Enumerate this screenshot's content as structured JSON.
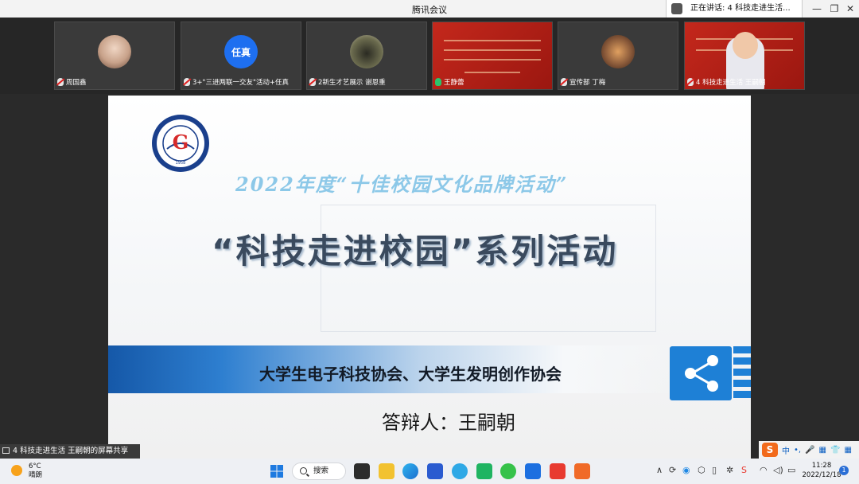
{
  "window": {
    "title": "腾讯会议",
    "speaking_now": "正在讲话: 4 科技走进生活..."
  },
  "participants": [
    {
      "name": "周国鑫",
      "mic": "muted",
      "avatar_type": "photo",
      "avatar_color": "#c8a28a"
    },
    {
      "name": "3+\"三进两联一交友\"活动+任真",
      "mic": "muted",
      "avatar_type": "text",
      "avatar_text": "任真"
    },
    {
      "name": "2新生才艺展示 谢恩重",
      "mic": "muted",
      "avatar_type": "photo",
      "avatar_color": "#6b6b4e"
    },
    {
      "name": "王静蕾",
      "mic": "on",
      "avatar_type": "slide"
    },
    {
      "name": "宣传部 丁梅",
      "mic": "muted",
      "avatar_type": "photo",
      "avatar_color": "#8a5a3a"
    },
    {
      "name": "4 科技走进生活 王嗣朝",
      "mic": "muted",
      "avatar_type": "slide-person"
    }
  ],
  "slide": {
    "subtitle": "2022年度“十佳校园文化品牌活动”",
    "title": "“科技走进校园”系列活动",
    "band_text": "大学生电子科技协会、大学生发明创作协会",
    "defender": "答辩人：王嗣朝",
    "logo_letter": "G",
    "logo_year": "1958"
  },
  "share_notice": "4 科技走进生活 王嗣朝的屏幕共享",
  "ime": {
    "logo": "S",
    "mode": "中"
  },
  "taskbar": {
    "weather_temp": "6°C",
    "weather_desc": "晴朗",
    "search_label": "搜索",
    "time": "11:28",
    "date": "2022/12/18",
    "notification_count": "1"
  }
}
